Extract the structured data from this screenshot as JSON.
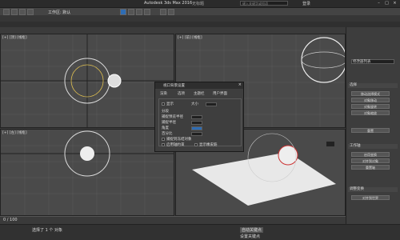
{
  "titlebar": {
    "app_title": "Autodesk 3ds Max 2016",
    "file_title": "无标题",
    "search_placeholder": "键入关键字或短语",
    "login": "登录"
  },
  "menubar": {
    "workspace": "工作区: 默认"
  },
  "viewports": {
    "top_left": "[+] [顶] [线框]",
    "top_right": "[+] [前] [线框]",
    "bottom_left": "[+] [左] [线框]",
    "bottom_right": "[+] [透视] [真实]"
  },
  "dialog": {
    "title": "视口背景设置",
    "tabs": [
      "渲染",
      "选项",
      "主题栏",
      "用户界面"
    ],
    "show_label": "显示",
    "size_label": "大小",
    "seg_label": "分段",
    "row1": "捕捉预览半径",
    "row2": "捕捉半径",
    "angle": "角度",
    "percent": "百分比",
    "option1": "捕捉到冻结对象",
    "option2": "启用轴约束",
    "option3": "显示橡皮筋"
  },
  "cmdpanel": {
    "modifier_list": "修改器列表",
    "sections": [
      "选择",
      "工作轴",
      "调整变换"
    ],
    "buttons": [
      "移动选择模式",
      "对象移动",
      "对象旋转",
      "对象缩放",
      "重置",
      "启用变换",
      "对齐到对象",
      "重置轴",
      "对齐到世界"
    ]
  },
  "statusbar": {
    "selection": "选择了 1 个 对象",
    "frame": "0 / 100",
    "key": "自动关键点",
    "set_key": "设置关键点"
  },
  "colors": {
    "accent": "#2e6db4",
    "bg": "#4a4a4a",
    "grid": "#5a5a5a"
  }
}
